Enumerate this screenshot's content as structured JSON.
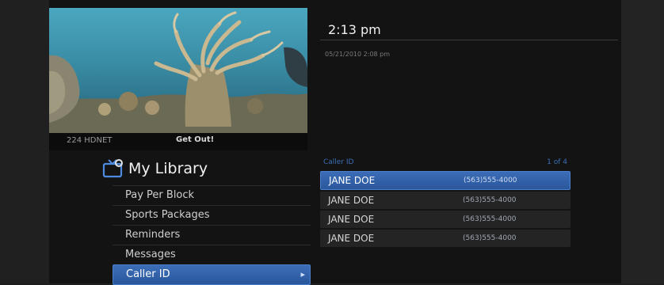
{
  "preview": {
    "channel": "224 HDNET",
    "program": "Get Out!"
  },
  "library": {
    "title": "My Library",
    "icon": "tv-icon",
    "menu": [
      {
        "label": "Pay Per Block"
      },
      {
        "label": "Sports Packages"
      },
      {
        "label": "Reminders"
      },
      {
        "label": "Messages"
      },
      {
        "label": "Caller ID",
        "selected": true
      }
    ]
  },
  "detail": {
    "time": "2:13 pm",
    "timestamp": "05/21/2010 2:08 pm"
  },
  "caller_id": {
    "header": "Caller ID",
    "page": "1 of 4",
    "rows": [
      {
        "name": "JANE DOE",
        "phone": "(563)555-4000",
        "selected": true
      },
      {
        "name": "JANE DOE",
        "phone": "(563)555-4000"
      },
      {
        "name": "JANE DOE",
        "phone": "(563)555-4000"
      },
      {
        "name": "JANE DOE",
        "phone": "(563)555-4000"
      }
    ]
  },
  "colors": {
    "accent": "#2f5fa8",
    "background": "#131313"
  }
}
